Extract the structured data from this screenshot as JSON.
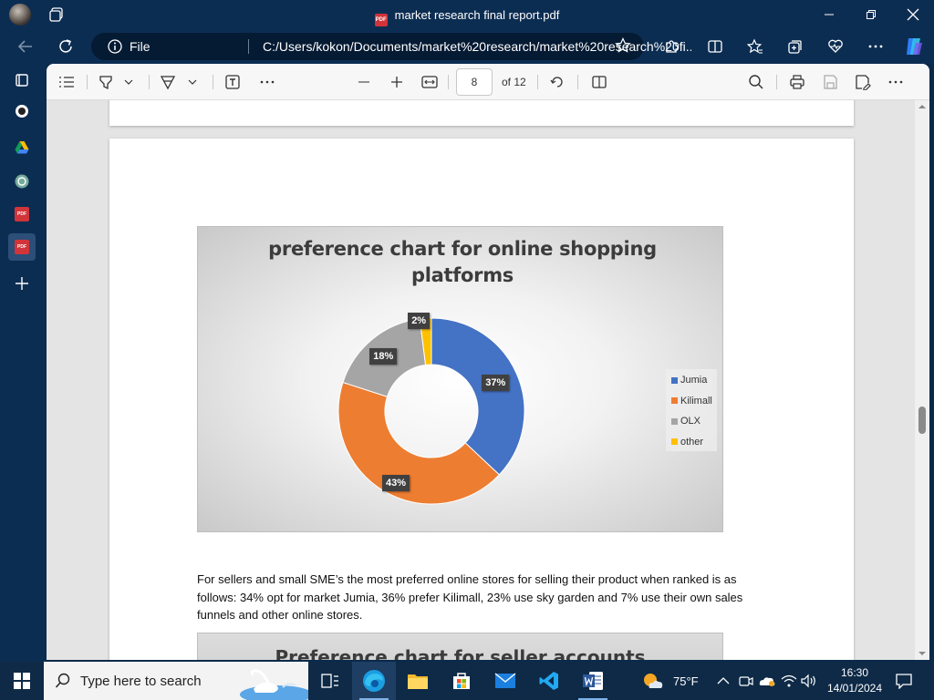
{
  "browser": {
    "tab_title": "market research final report.pdf",
    "file_label": "File",
    "url": "C:/Users/kokon/Documents/market%20research/market%20research%20fi..."
  },
  "pdf_toolbar": {
    "page_current": "8",
    "page_total": "of 12"
  },
  "chart_data": {
    "type": "pie",
    "title": "preference  chart for online shopping platforms",
    "categories": [
      "Jumia",
      "Kilimall",
      "OLX",
      "other"
    ],
    "values": [
      37,
      43,
      18,
      2
    ],
    "labels": [
      "37%",
      "43%",
      "18%",
      "2%"
    ],
    "colors": [
      "#4472c4",
      "#ed7d31",
      "#a5a5a5",
      "#ffc000"
    ],
    "donut": true,
    "legend_position": "right"
  },
  "paragraph": "For sellers and small SME’s the most preferred online stores for selling their product when ranked is as follows: 34% opt for market Jumia, 36% prefer Kilimall, 23% use sky garden and 7% use their own sales funnels and other online stores.",
  "next_chart_title": "Preference chart for seller accounts",
  "taskbar": {
    "search_placeholder": "Type here to search",
    "weather": "75°F",
    "time": "16:30",
    "date": "14/01/2024"
  }
}
